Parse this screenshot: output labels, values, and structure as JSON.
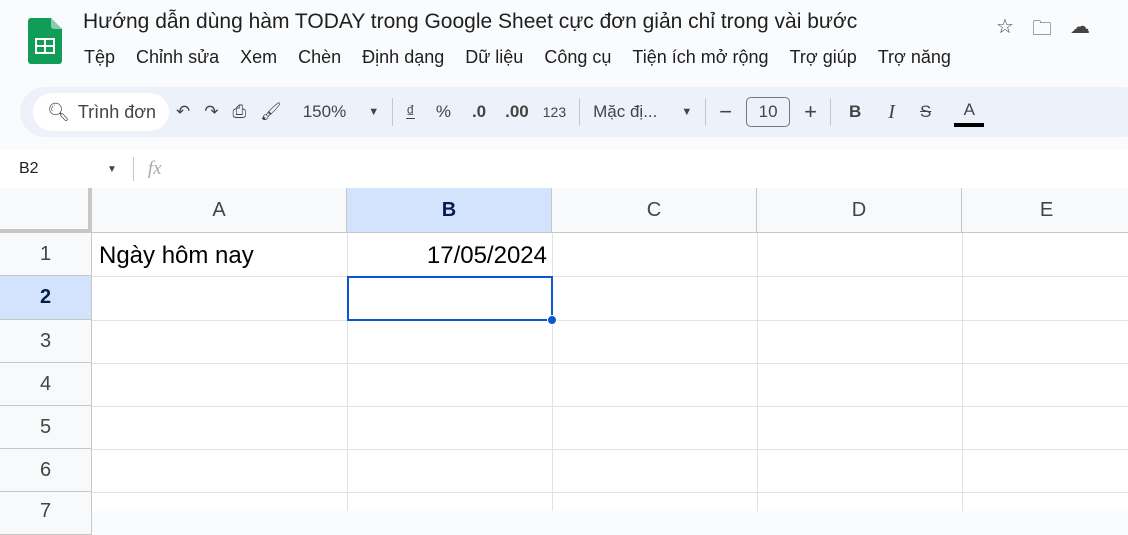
{
  "doc_title": "Hướng dẫn dùng hàm TODAY trong Google Sheet cực đơn giản chỉ trong vài bước",
  "menu": [
    "Tệp",
    "Chỉnh sửa",
    "Xem",
    "Chèn",
    "Định dạng",
    "Dữ liệu",
    "Công cụ",
    "Tiện ích mở rộng",
    "Trợ giúp",
    "Trợ năng"
  ],
  "toolbar": {
    "search": "Trình đơn",
    "zoom": "150%",
    "currency": "₫",
    "percent": "%",
    "dec_decrease": ".0",
    "dec_increase": ".00",
    "format_123": "123",
    "font": "Mặc đị...",
    "font_size": "10",
    "minus": "−",
    "plus": "+",
    "bold": "B",
    "italic": "I",
    "strike": "S",
    "text_color": "A"
  },
  "formula_bar": {
    "name_box": "B2",
    "fx": "fx",
    "value": ""
  },
  "columns": [
    "A",
    "B",
    "C",
    "D",
    "E"
  ],
  "rows": [
    "1",
    "2",
    "3",
    "4",
    "5",
    "6",
    "7"
  ],
  "cells": {
    "A1": "Ngày hôm nay",
    "B1": "17/05/2024"
  },
  "colors": {
    "accent": "#0b57d0",
    "selected_header": "#d3e3fd"
  }
}
